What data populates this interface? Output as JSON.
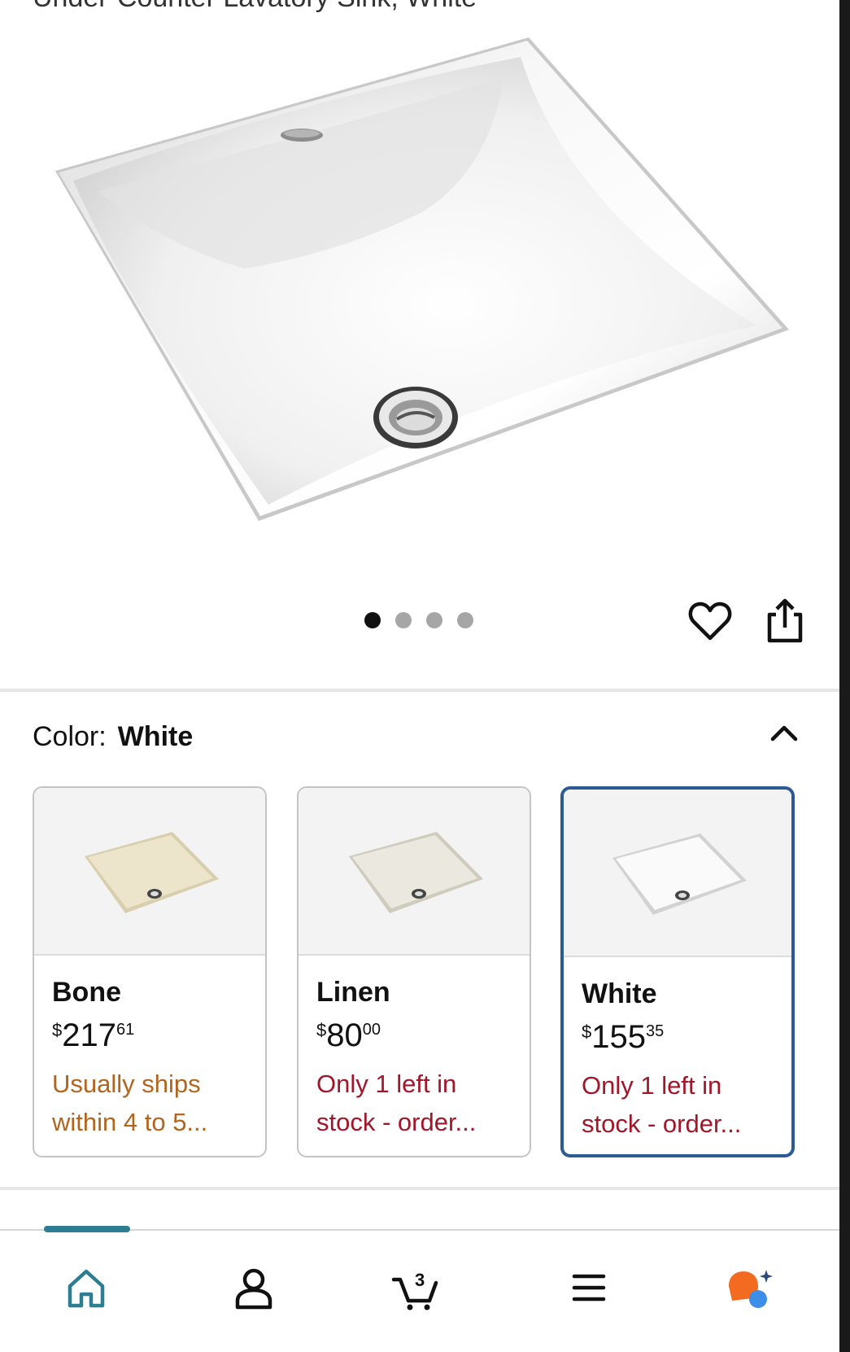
{
  "product": {
    "cut_title": "Under-Counter Lavatory Sink, White"
  },
  "gallery": {
    "image_count": 4,
    "active_index": 0
  },
  "color_selector": {
    "label": "Color:",
    "selected": "White",
    "options": [
      {
        "name": "Bone",
        "currency": "$",
        "whole": "217",
        "fraction": "61",
        "availability": "Usually ships within 4 to 5...",
        "availability_color": "#b1651f",
        "swatch": "#e9e1c6"
      },
      {
        "name": "Linen",
        "currency": "$",
        "whole": "80",
        "fraction": "00",
        "availability": "Only 1 left in stock - order...",
        "availability_color": "#a3162a",
        "swatch": "#e8e6dd"
      },
      {
        "name": "White",
        "currency": "$",
        "whole": "155",
        "fraction": "35",
        "availability": "Only 1 left in stock - order...",
        "availability_color": "#a3162a",
        "swatch": "#f4f4f4"
      }
    ]
  },
  "bottom_nav": {
    "cart_count": "3",
    "items": [
      "home-icon",
      "account-icon",
      "cart-icon",
      "menu-icon",
      "assistant-icon"
    ]
  },
  "colors": {
    "selected_border": "#2d5a95",
    "nav_accent": "#2e7e93",
    "assistant_orange": "#f26b21",
    "assistant_blue": "#3d8ee8"
  }
}
